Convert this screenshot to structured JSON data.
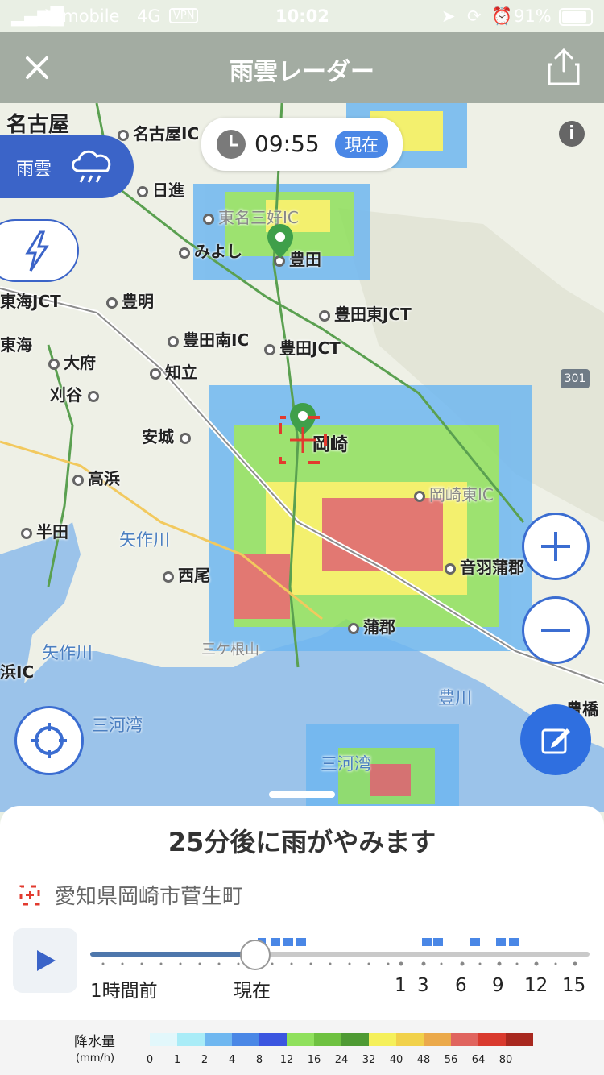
{
  "status": {
    "carrier": "Y!mobile",
    "network": "4G",
    "vpn": "VPN",
    "time": "10:02",
    "battery": "91%"
  },
  "header": {
    "title": "雨雲レーダー"
  },
  "map": {
    "time": "09:55",
    "now_label": "現在",
    "mode_label": "雨雲",
    "places": [
      {
        "id": "nagoya",
        "label": "名古屋"
      },
      {
        "id": "nagoya-ic",
        "label": "名古屋IC"
      },
      {
        "id": "nisshin",
        "label": "日進"
      },
      {
        "id": "tomei-miyoshi-ic",
        "label": "東名三好IC"
      },
      {
        "id": "miyoshi",
        "label": "みよし"
      },
      {
        "id": "toyota",
        "label": "豊田"
      },
      {
        "id": "toyoake",
        "label": "豊明"
      },
      {
        "id": "tokai-jct",
        "label": "東海JCT"
      },
      {
        "id": "toyotahigashi-jct",
        "label": "豊田東JCT"
      },
      {
        "id": "toyotaminami-ic",
        "label": "豊田南IC"
      },
      {
        "id": "toyota-jct",
        "label": "豊田JCT"
      },
      {
        "id": "tokai",
        "label": "東海"
      },
      {
        "id": "obu",
        "label": "大府"
      },
      {
        "id": "chiryu",
        "label": "知立"
      },
      {
        "id": "kariya",
        "label": "刈谷"
      },
      {
        "id": "anjo",
        "label": "安城"
      },
      {
        "id": "okazaki",
        "label": "岡崎"
      },
      {
        "id": "takahama",
        "label": "高浜"
      },
      {
        "id": "okazakihigashi-ic",
        "label": "岡崎東IC"
      },
      {
        "id": "handa",
        "label": "半田"
      },
      {
        "id": "yahagigawa-1",
        "label": "矢作川"
      },
      {
        "id": "otowagamagori",
        "label": "音羽蒲郡"
      },
      {
        "id": "nishio",
        "label": "西尾"
      },
      {
        "id": "gamagori",
        "label": "蒲郡"
      },
      {
        "id": "sangane",
        "label": "三ケ根山"
      },
      {
        "id": "yahagigawa-2",
        "label": "矢作川"
      },
      {
        "id": "hama-ic",
        "label": "浜IC"
      },
      {
        "id": "toyogawa",
        "label": "豊川"
      },
      {
        "id": "toyohashi",
        "label": "豊橋"
      },
      {
        "id": "mikawawan-1",
        "label": "三河湾"
      },
      {
        "id": "mikawawan-2",
        "label": "三河湾"
      },
      {
        "id": "route-301",
        "label": "301"
      }
    ]
  },
  "sheet": {
    "headline": "25分後に雨がやみます",
    "location": "愛知県岡崎市菅生町",
    "timeline": {
      "labels": [
        "1時間前",
        "現在",
        "1",
        "3",
        "6",
        "9",
        "12",
        "15"
      ],
      "progress": 0.33
    },
    "legend": {
      "title": "降水量",
      "unit": "(mm/h)",
      "values": [
        "0",
        "1",
        "2",
        "4",
        "8",
        "12",
        "16",
        "24",
        "32",
        "40",
        "48",
        "56",
        "64",
        "80"
      ],
      "colors": [
        "#e2f7fb",
        "#a9ecf7",
        "#6fb7f0",
        "#4a87e6",
        "#3b55e0",
        "#8fe05c",
        "#6ec140",
        "#4e9a33",
        "#f5f05a",
        "#f1d14a",
        "#eba94a",
        "#e0645e",
        "#d93a2e",
        "#a8281f"
      ]
    }
  }
}
